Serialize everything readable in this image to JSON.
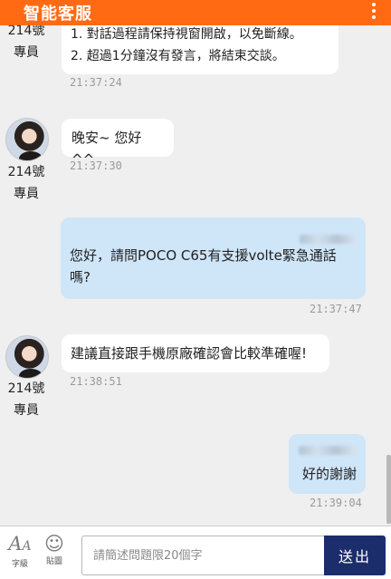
{
  "header": {
    "title": "智能客服"
  },
  "messages": [
    {
      "type": "agent-partial",
      "lines": [
        "1. 對話過程請保持視窗開啟，以免斷線。",
        "2. 超過1分鐘沒有發言，將結束交談。"
      ],
      "time": "21:37:24",
      "agent": [
        "214號",
        "專員"
      ]
    },
    {
      "type": "agent",
      "text": "晚安~ 您好 ^^",
      "time": "21:37:30",
      "agent": [
        "214號",
        "專員"
      ]
    },
    {
      "type": "user",
      "lines": [
        "您好，請問POCO C65有支援volte緊急通話",
        "嗎?"
      ],
      "time": "21:37:47"
    },
    {
      "type": "agent",
      "text": "建議直接跟手機原廠確認會比較準確喔!",
      "time": "21:38:51",
      "agent": [
        "214號",
        "專員"
      ]
    },
    {
      "type": "user",
      "text": "好的謝謝",
      "time": "21:39:04"
    }
  ],
  "footer": {
    "font_label": "字級",
    "sticker_label": "貼圖",
    "input_placeholder": "請簡述問題限20個字",
    "send_label": "送出"
  },
  "icons": {
    "font": "font-size-icon",
    "sticker": "smiley-icon",
    "menu": "more-vertical-icon"
  }
}
